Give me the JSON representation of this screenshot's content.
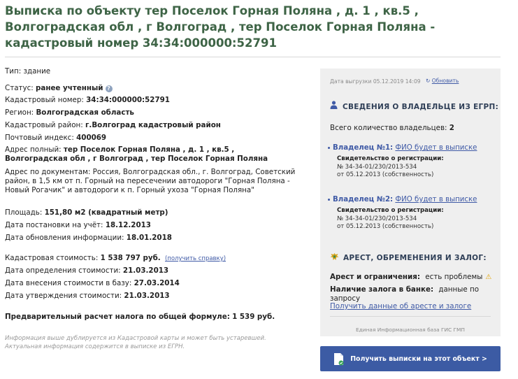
{
  "title": "Выписка по объекту тер Поселок Горная Поляна , д. 1 , кв.5 , Волгоградская обл , г Волгоград , тер Поселок Горная Поляна - кадастровый номер 34:34:000000:52791",
  "info": {
    "type_label": "Тип:",
    "type_value": "здание",
    "status_label": "Статус:",
    "status_value": "ранее учтенный",
    "cadnum_label": "Кадастровый номер:",
    "cadnum_value": "34:34:000000:52791",
    "region_label": "Регион:",
    "region_value": "Волгоградская область",
    "district_label": "Кадастровый район:",
    "district_value": "г.Волгоград кадастровый район",
    "postcode_label": "Почтовый индекс:",
    "postcode_value": "400069",
    "address_full_label": "Адрес полный:",
    "address_full_value": "тер Поселок Горная Поляна , д. 1 , кв.5 , Волгоградская обл , г Волгоград , тер Поселок Горная Поляна",
    "address_docs_label": "Адрес по документам:",
    "address_docs_value": "Россия, Волгоградская обл., г. Волгоград, Советский район, в 1,5 км от п. Горный на пересечении автодороги \"Горная Поляна - Новый Рогачик\" и автодороги к п. Горный ухоза \"Горная Поляна\"",
    "area_label": "Площадь:",
    "area_value": "151,80 м2 (квадратный метр)",
    "registered_label": "Дата постановки на учёт:",
    "registered_value": "18.12.2013",
    "updated_label": "Дата обновления информации:",
    "updated_value": "18.01.2018",
    "cost_label": "Кадастровая стоимость:",
    "cost_value": "1 538 797 руб.",
    "cost_link": "(получить справку)",
    "cost_det_label": "Дата определения стоимости:",
    "cost_det_value": "21.03.2013",
    "cost_entry_label": "Дата внесения стоимости в базу:",
    "cost_entry_value": "27.03.2014",
    "cost_appr_label": "Дата утверждения стоимости:",
    "cost_appr_value": "21.03.2013",
    "tax_label": "Предварительный расчет налога по общей формуле:",
    "tax_value": "1 539 руб.",
    "note": "Информация выше дублируется из Кадастровой карты и может быть устаревшей. Актуальная информация содержится в выписке из ЕГРН."
  },
  "panel": {
    "export_text": "Дата выгрузки 05.12.2019 14:09",
    "refresh_label": "Обновить",
    "owners_heading": "СВЕДЕНИЯ О ВЛАДЕЛЬЦЕ ИЗ ЕГРП:",
    "owners_count_label": "Всего количество владельцев:",
    "owners_count_value": "2",
    "owners": [
      {
        "label": "Владелец №1:",
        "name": "ФИО будет в выписке",
        "reg_label": "Свидетельство о регистрации:",
        "reg_num": "№ 34-34-01/230/2013-534",
        "reg_date": "от 05.12.2013 (собственность)"
      },
      {
        "label": "Владелец №2:",
        "name": "ФИО будет в выписке",
        "reg_label": "Свидетельство о регистрации:",
        "reg_num": "№ 34-34-01/230/2013-534",
        "reg_date": "от 05.12.2013 (собственность)"
      }
    ],
    "arrest_heading": "АРЕСТ, ОБРЕМЕНЕНИЯ И ЗАЛОГ:",
    "arrest_label": "Арест и ограничения:",
    "arrest_value": "есть проблемы",
    "pledge_label": "Наличие залога в банке:",
    "pledge_value": "данные по запросу",
    "arrest_link": "Получить данные об аресте и залоге",
    "footer": "Единая Информационная база ГИС ГМП",
    "cta_label": "Получить выписки на этот объект >"
  },
  "colors": {
    "title": "#3e6446",
    "accent": "#3f5aa6",
    "button": "#3c5ba4",
    "panel_bg": "#efefef",
    "warning": "#e2a200"
  }
}
